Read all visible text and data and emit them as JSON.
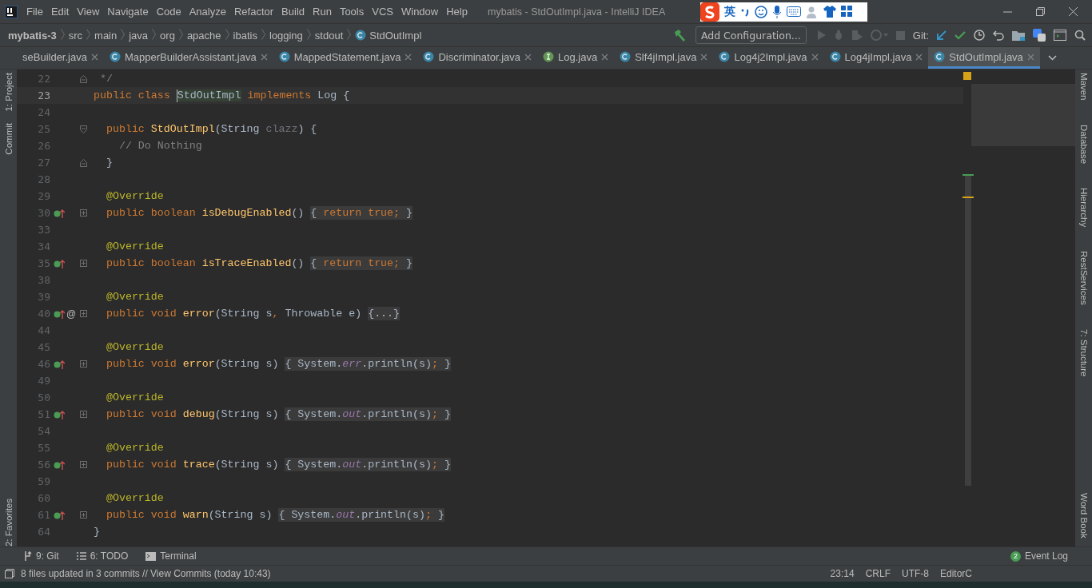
{
  "window": {
    "title": "mybatis - StdOutImpl.java - IntelliJ IDEA"
  },
  "menu": [
    "File",
    "Edit",
    "View",
    "Navigate",
    "Code",
    "Analyze",
    "Refactor",
    "Build",
    "Run",
    "Tools",
    "VCS",
    "Window",
    "Help"
  ],
  "ime": {
    "language": "英"
  },
  "breadcrumbs": [
    "mybatis-3",
    "src",
    "main",
    "java",
    "org",
    "apache",
    "ibatis",
    "logging",
    "stdout",
    "StdOutImpl"
  ],
  "toolbar": {
    "run_config": "Add Configuration...",
    "git_label": "Git:"
  },
  "tabs": [
    {
      "label": "seBuilder.java",
      "kind": "plain",
      "selected": false
    },
    {
      "label": "MapperBuilderAssistant.java",
      "kind": "class",
      "selected": false
    },
    {
      "label": "MappedStatement.java",
      "kind": "class",
      "selected": false
    },
    {
      "label": "Discriminator.java",
      "kind": "class",
      "selected": false
    },
    {
      "label": "Log.java",
      "kind": "interface",
      "selected": false
    },
    {
      "label": "Slf4jImpl.java",
      "kind": "class",
      "selected": false
    },
    {
      "label": "Log4j2Impl.java",
      "kind": "class",
      "selected": false
    },
    {
      "label": "Log4jImpl.java",
      "kind": "class",
      "selected": false
    },
    {
      "label": "StdOutImpl.java",
      "kind": "class",
      "selected": true
    }
  ],
  "left_tools": [
    "1: Project",
    "Commit",
    "2: Favorites"
  ],
  "right_tools": [
    "Maven",
    "Database",
    "Hierarchy",
    "RestServices",
    "7: Structure",
    "Word Book"
  ],
  "lines": [
    {
      "number": "22",
      "kind": "fold-end",
      "tokens": [
        {
          "kind": "comment",
          "text": " */"
        }
      ]
    },
    {
      "number": "23",
      "kind": "plain",
      "current": true,
      "tokens": [
        {
          "kind": "keyword",
          "text": "public class "
        },
        {
          "kind": "plain",
          "text": "StdOutImpl",
          "caret": true
        },
        {
          "kind": "keyword",
          "text": " implements "
        },
        {
          "kind": "plain",
          "text": "Log {"
        }
      ]
    },
    {
      "number": "24",
      "kind": "plain"
    },
    {
      "number": "25",
      "kind": "fold-start",
      "tokens": [
        {
          "kind": "keyword",
          "text": "  public "
        },
        {
          "kind": "method",
          "text": "StdOutImpl"
        },
        {
          "kind": "plain",
          "text": "(String "
        },
        {
          "kind": "unused",
          "text": "clazz"
        },
        {
          "kind": "plain",
          "text": ") {"
        }
      ]
    },
    {
      "number": "26",
      "kind": "plain",
      "tokens": [
        {
          "kind": "comment",
          "text": "    // Do Nothing"
        }
      ]
    },
    {
      "number": "27",
      "kind": "fold-end",
      "tokens": [
        {
          "kind": "plain",
          "text": "  }"
        }
      ]
    },
    {
      "number": "28",
      "kind": "plain"
    },
    {
      "number": "29",
      "kind": "plain",
      "tokens": [
        {
          "kind": "annotation",
          "text": "  @Override"
        }
      ]
    },
    {
      "number": "30",
      "kind": "collapsed",
      "implements": true,
      "tokens": [
        {
          "kind": "keyword",
          "text": "  public boolean "
        },
        {
          "kind": "method",
          "text": "isDebugEnabled"
        },
        {
          "kind": "plain",
          "text": "() "
        },
        {
          "kind": "folded",
          "tokens": [
            {
              "kind": "plain",
              "text": "{ "
            },
            {
              "kind": "keyword",
              "text": "return true;"
            },
            {
              "kind": "plain",
              "text": " }"
            }
          ]
        }
      ]
    },
    {
      "number": "33",
      "kind": "plain"
    },
    {
      "number": "34",
      "kind": "plain",
      "tokens": [
        {
          "kind": "annotation",
          "text": "  @Override"
        }
      ]
    },
    {
      "number": "35",
      "kind": "collapsed",
      "implements": true,
      "tokens": [
        {
          "kind": "keyword",
          "text": "  public boolean "
        },
        {
          "kind": "method",
          "text": "isTraceEnabled"
        },
        {
          "kind": "plain",
          "text": "() "
        },
        {
          "kind": "folded",
          "tokens": [
            {
              "kind": "plain",
              "text": "{ "
            },
            {
              "kind": "keyword",
              "text": "return true;"
            },
            {
              "kind": "plain",
              "text": " }"
            }
          ]
        }
      ]
    },
    {
      "number": "38",
      "kind": "plain"
    },
    {
      "number": "39",
      "kind": "plain",
      "tokens": [
        {
          "kind": "annotation",
          "text": "  @Override"
        }
      ]
    },
    {
      "number": "40",
      "kind": "collapsed",
      "implements": true,
      "mention": "@",
      "tokens": [
        {
          "kind": "keyword",
          "text": "  public void "
        },
        {
          "kind": "method",
          "text": "error"
        },
        {
          "kind": "plain",
          "text": "(String s"
        },
        {
          "kind": "keyword",
          "text": ", "
        },
        {
          "kind": "plain",
          "text": "Throwable e) "
        },
        {
          "kind": "folded",
          "tokens": [
            {
              "kind": "plain",
              "text": "{...}"
            }
          ]
        }
      ]
    },
    {
      "number": "44",
      "kind": "plain"
    },
    {
      "number": "45",
      "kind": "plain",
      "tokens": [
        {
          "kind": "annotation",
          "text": "  @Override"
        }
      ]
    },
    {
      "number": "46",
      "kind": "collapsed",
      "implements": true,
      "tokens": [
        {
          "kind": "keyword",
          "text": "  public void "
        },
        {
          "kind": "method",
          "text": "error"
        },
        {
          "kind": "plain",
          "text": "(String s) "
        },
        {
          "kind": "folded",
          "tokens": [
            {
              "kind": "plain",
              "text": "{ System."
            },
            {
              "kind": "field",
              "text": "err"
            },
            {
              "kind": "plain",
              "text": ".println(s)"
            },
            {
              "kind": "keyword",
              "text": ";"
            },
            {
              "kind": "plain",
              "text": " }"
            }
          ]
        }
      ]
    },
    {
      "number": "49",
      "kind": "plain"
    },
    {
      "number": "50",
      "kind": "plain",
      "tokens": [
        {
          "kind": "annotation",
          "text": "  @Override"
        }
      ]
    },
    {
      "number": "51",
      "kind": "collapsed",
      "implements": true,
      "tokens": [
        {
          "kind": "keyword",
          "text": "  public void "
        },
        {
          "kind": "method",
          "text": "debug"
        },
        {
          "kind": "plain",
          "text": "(String s) "
        },
        {
          "kind": "folded",
          "tokens": [
            {
              "kind": "plain",
              "text": "{ System."
            },
            {
              "kind": "field",
              "text": "out"
            },
            {
              "kind": "plain",
              "text": ".println(s)"
            },
            {
              "kind": "keyword",
              "text": ";"
            },
            {
              "kind": "plain",
              "text": " }"
            }
          ]
        }
      ]
    },
    {
      "number": "54",
      "kind": "plain"
    },
    {
      "number": "55",
      "kind": "plain",
      "tokens": [
        {
          "kind": "annotation",
          "text": "  @Override"
        }
      ]
    },
    {
      "number": "56",
      "kind": "collapsed",
      "implements": true,
      "tokens": [
        {
          "kind": "keyword",
          "text": "  public void "
        },
        {
          "kind": "method",
          "text": "trace"
        },
        {
          "kind": "plain",
          "text": "(String s) "
        },
        {
          "kind": "folded",
          "tokens": [
            {
              "kind": "plain",
              "text": "{ System."
            },
            {
              "kind": "field",
              "text": "out"
            },
            {
              "kind": "plain",
              "text": ".println(s)"
            },
            {
              "kind": "keyword",
              "text": ";"
            },
            {
              "kind": "plain",
              "text": " }"
            }
          ]
        }
      ]
    },
    {
      "number": "59",
      "kind": "plain"
    },
    {
      "number": "60",
      "kind": "plain",
      "tokens": [
        {
          "kind": "annotation",
          "text": "  @Override"
        }
      ]
    },
    {
      "number": "61",
      "kind": "collapsed",
      "implements": true,
      "tokens": [
        {
          "kind": "keyword",
          "text": "  public void "
        },
        {
          "kind": "method",
          "text": "warn"
        },
        {
          "kind": "plain",
          "text": "(String s) "
        },
        {
          "kind": "folded",
          "tokens": [
            {
              "kind": "plain",
              "text": "{ System."
            },
            {
              "kind": "field",
              "text": "out"
            },
            {
              "kind": "plain",
              "text": ".println(s)"
            },
            {
              "kind": "keyword",
              "text": ";"
            },
            {
              "kind": "plain",
              "text": " }"
            }
          ]
        }
      ]
    },
    {
      "number": "64",
      "kind": "plain",
      "tokens": [
        {
          "kind": "plain",
          "text": "}"
        }
      ]
    }
  ],
  "bottom_tools": [
    {
      "label": "9: Git",
      "kind": "git"
    },
    {
      "label": "6: TODO",
      "kind": "list"
    },
    {
      "label": "Terminal",
      "kind": "terminal"
    }
  ],
  "event_log": {
    "count": "2",
    "label": "Event Log"
  },
  "status_bar": {
    "message": "8 files updated in 3 commits // View Commits (today 10:43)",
    "items": [
      "23:14",
      "CRLF",
      "UTF-8",
      "EditorC"
    ]
  }
}
